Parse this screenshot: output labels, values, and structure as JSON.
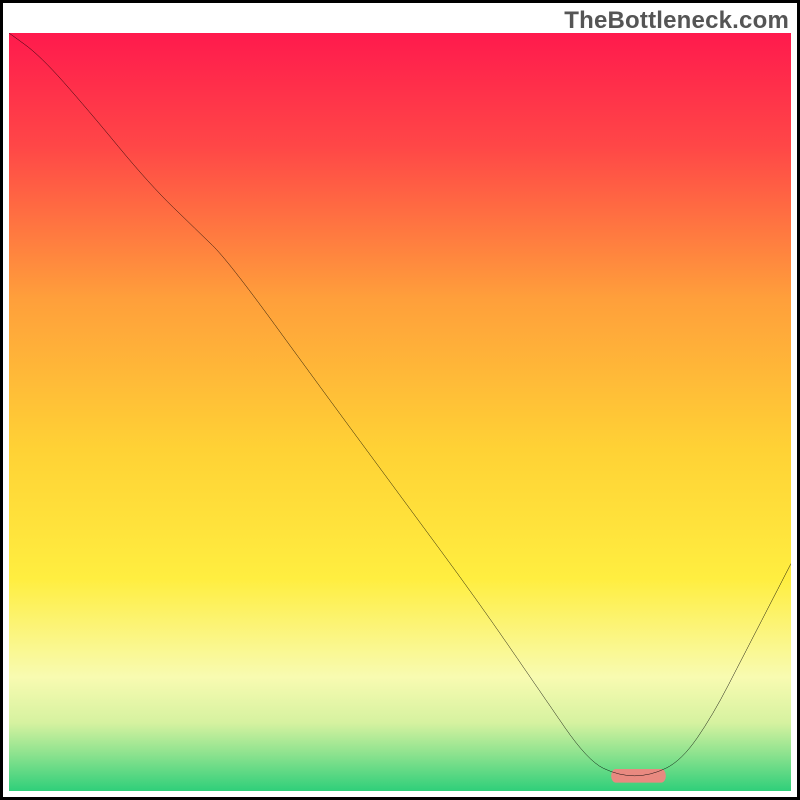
{
  "watermark": "TheBottleneck.com",
  "chart_data": {
    "type": "line",
    "title": "",
    "xlabel": "",
    "ylabel": "",
    "xlim": [
      0,
      100
    ],
    "ylim": [
      0,
      100
    ],
    "series": [
      {
        "name": "curve",
        "x": [
          0,
          4,
          10,
          18,
          24,
          28,
          40,
          50,
          60,
          68,
          74,
          78,
          82,
          86,
          90,
          94,
          100
        ],
        "values": [
          100,
          97,
          90,
          80,
          74,
          70,
          53,
          39,
          25,
          13,
          4,
          2,
          2,
          4,
          10,
          18,
          30
        ]
      }
    ],
    "marker": {
      "x_start": 77,
      "x_end": 84,
      "y": 2,
      "color": "#e98980"
    }
  },
  "gradient": {
    "stops": [
      {
        "offset": 0.0,
        "color": "#ff1a4d"
      },
      {
        "offset": 0.15,
        "color": "#ff4747"
      },
      {
        "offset": 0.35,
        "color": "#ff9f3b"
      },
      {
        "offset": 0.55,
        "color": "#ffd235"
      },
      {
        "offset": 0.72,
        "color": "#ffee40"
      },
      {
        "offset": 0.85,
        "color": "#f8fbb1"
      },
      {
        "offset": 0.91,
        "color": "#d6f2a0"
      },
      {
        "offset": 0.95,
        "color": "#8fe38f"
      },
      {
        "offset": 1.0,
        "color": "#2fcf7a"
      }
    ]
  }
}
